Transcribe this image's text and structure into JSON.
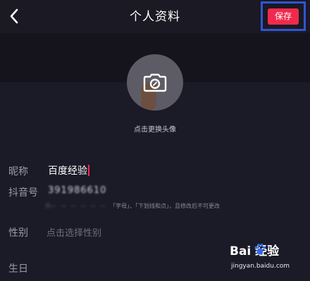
{
  "header": {
    "title": "个人资料",
    "save_label": "保存"
  },
  "avatar": {
    "hint": "点击更换头像"
  },
  "form": {
    "nickname": {
      "label": "昵称",
      "value": "百度经验"
    },
    "douyin_id": {
      "label": "抖音号",
      "value": "391986610",
      "hint_blurred": "只",
      "hint_text": "「字母」、「下划线和点」，且修改后不可更改"
    },
    "gender": {
      "label": "性别",
      "placeholder": "点击选择性别"
    },
    "birthday": {
      "label": "生日"
    }
  },
  "watermark": {
    "logo_text": "Bai 经验",
    "url": "jingyan.baidu.com"
  },
  "colors": {
    "background": "#1b1a27",
    "accent": "#f12a4d",
    "highlight_frame": "#2f55d4"
  },
  "icons": {
    "back": "chevron-left-icon",
    "camera": "camera-icon"
  }
}
